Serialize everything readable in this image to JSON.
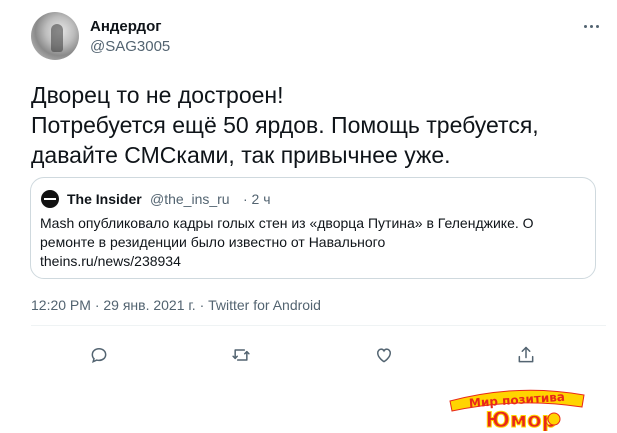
{
  "author": {
    "display_name": "Андердог",
    "handle": "@SAG3005"
  },
  "tweet": {
    "lines": [
      "Дворец то не достроен!",
      "Потребуется ещё 50 ярдов. Помощь требуется,",
      "давайте СМСками, так привычнее уже."
    ]
  },
  "quote": {
    "display_name": "The Insider",
    "handle": "@the_ins_ru",
    "time": "· 2 ч",
    "body_lines": [
      "Mash опубликовало кадры голых стен из «дворца Путина» в Геленджике. О",
      "ремонте в резиденции было известно от Навального",
      "theins.ru/news/238934"
    ]
  },
  "meta": "12:20 PM · 29 янв. 2021 г. · Twitter for Android",
  "actions": [
    "reply-icon",
    "retweet-icon",
    "like-icon",
    "share-icon"
  ],
  "watermark": {
    "line1": "Мир позитива",
    "line2": "Юмор"
  },
  "colors": {
    "text": "#0f1419",
    "secondary": "#536471",
    "border": "#cfd9de",
    "watermark_yellow": "#ffd400",
    "watermark_red": "#e8281a"
  }
}
